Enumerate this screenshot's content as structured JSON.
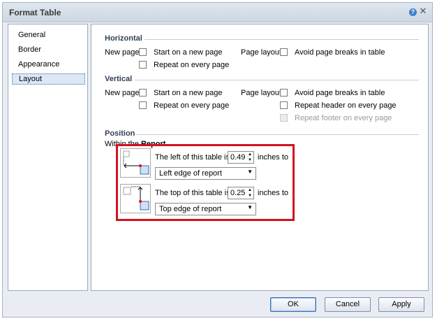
{
  "dialog": {
    "title": "Format Table",
    "help_icon": "?"
  },
  "nav": {
    "items": [
      {
        "label": "General"
      },
      {
        "label": "Border"
      },
      {
        "label": "Appearance"
      },
      {
        "label": "Layout"
      }
    ],
    "selected": "Layout"
  },
  "horizontal": {
    "heading": "Horizontal",
    "new_page_label": "New page:",
    "start_new_page": "Start on a new page",
    "repeat_every_page": "Repeat on every page",
    "page_layout_label": "Page layout:",
    "avoid_breaks": "Avoid page breaks in table"
  },
  "vertical": {
    "heading": "Vertical",
    "new_page_label": "New page:",
    "start_new_page": "Start on a new page",
    "repeat_every_page": "Repeat on every page",
    "page_layout_label": "Page layout:",
    "avoid_breaks": "Avoid page breaks in table",
    "repeat_header": "Repeat header on every page",
    "repeat_footer": "Repeat footer on every page"
  },
  "position": {
    "heading": "Position",
    "within_prefix": "Within the ",
    "within_target": "Report",
    "left": {
      "prefix": "The left of this table is",
      "value": "0.49",
      "suffix": "inches to",
      "relative_to": "Left edge of report"
    },
    "top": {
      "prefix": "The top of this table is",
      "value": "0.25",
      "suffix": "inches to",
      "relative_to": "Top edge of report"
    }
  },
  "buttons": {
    "ok": "OK",
    "cancel": "Cancel",
    "apply": "Apply"
  },
  "colors": {
    "highlight": "#d3121e",
    "accent": "#3c7fc9"
  }
}
